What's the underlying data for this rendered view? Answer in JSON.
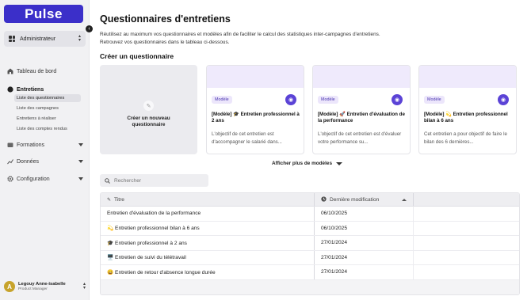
{
  "sidebar": {
    "logo": "Pulse",
    "role": "Administrateur",
    "nav": {
      "dashboard": "Tableau de bord",
      "interviews": "Entretiens",
      "trainings": "Formations",
      "data": "Données",
      "config": "Configuration"
    },
    "subitems": [
      "Liste des questionnaires",
      "Liste des campagnes",
      "Entretiens à réaliser",
      "Liste des comptes rendus"
    ],
    "user": {
      "initial": "A",
      "name": "Legouy Anne-isabelle",
      "role": "Product Manager"
    }
  },
  "main": {
    "title": "Questionnaires d'entretiens",
    "description_line1": "Réutilisez au maximum vos questionnaires et modèles afin de faciliter le calcul des statistiques inter-campagnes d'entretiens.",
    "description_line2": "Retrouvez vos questionnaires dans le tableau ci-dessous.",
    "create_heading": "Créer un questionnaire",
    "new_card_label": "Créer un nouveau questionnaire",
    "templates": [
      {
        "badge": "Modèle",
        "title": "[Modèle] 🎓 Entretien professionnel à 2 ans",
        "desc": "L'objectif de cet entretien est d'accompagner le salarié dans..."
      },
      {
        "badge": "Modèle",
        "title": "[Modèle] 🚀 Entretien d'évaluation de la performance",
        "desc": "L'objectif de cet entretien est d'évaluer votre performance su..."
      },
      {
        "badge": "Modèle",
        "title": "[Modèle] 💫 Entretien professionnel bilan à 6 ans",
        "desc": "Cet entretien a pour objectif de faire le bilan des 6 dernières..."
      }
    ],
    "show_more": "Afficher plus de modèles",
    "search_placeholder": "Rechercher",
    "table": {
      "col_title": "Titre",
      "col_modified": "Dernière modification",
      "rows": [
        {
          "title": "Entretien d'évaluation de la performance",
          "date": "06/10/2025"
        },
        {
          "title": "💫 Entretien professionnel bilan à 6 ans",
          "date": "06/10/2025"
        },
        {
          "title": "🎓 Entretien professionnel à 2 ans",
          "date": "27/01/2024"
        },
        {
          "title": "🖥️ Entretien de suivi du télétravail",
          "date": "27/01/2024"
        },
        {
          "title": "😀 Entretien de retour d'absence longue durée",
          "date": "27/01/2024"
        }
      ]
    }
  },
  "colors": {
    "brand": "#3b2fc9",
    "accent": "#5b43d6",
    "avatar": "#c7a32b"
  }
}
